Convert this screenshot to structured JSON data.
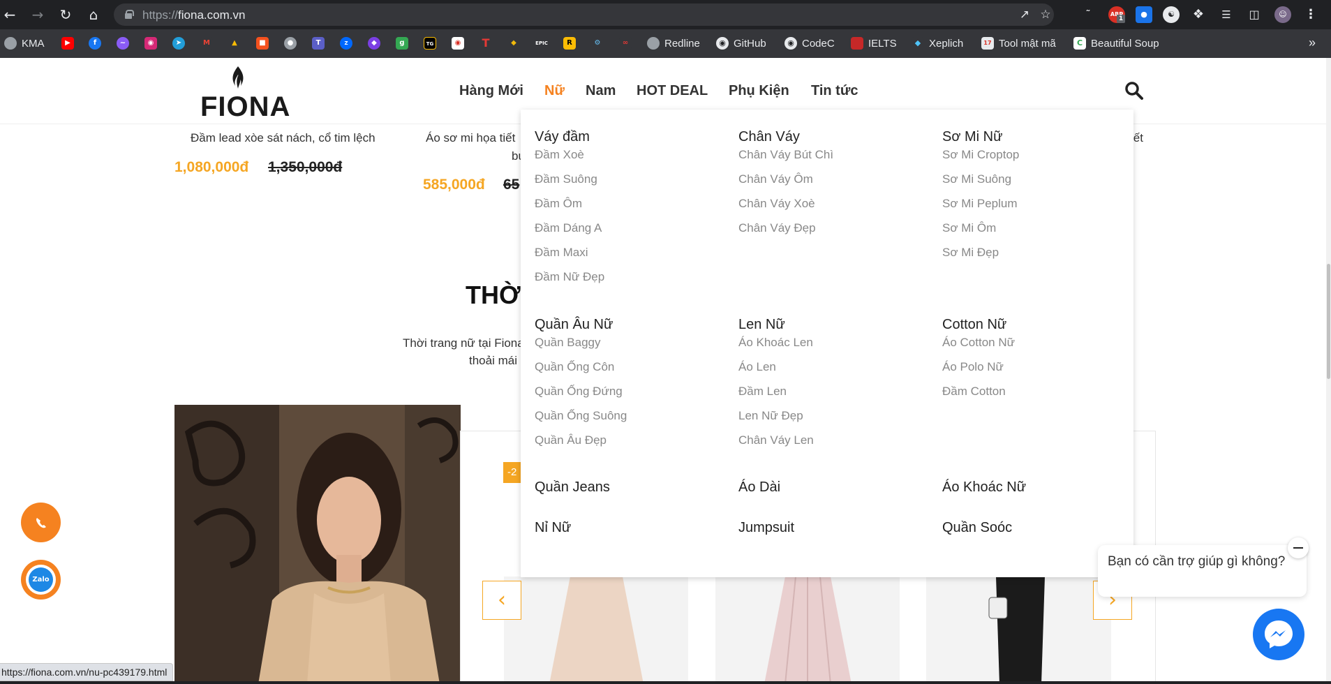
{
  "browser": {
    "url_scheme": "https://",
    "url_host": "fiona.com.vn",
    "status_url": "https://fiona.com.vn/nu-pc439179.html",
    "extension_badge": "1",
    "bookmarks": [
      {
        "label": "KMA",
        "icon": "globe-icon"
      },
      {
        "label": "Redline",
        "icon": "globe-icon"
      },
      {
        "label": "GitHub",
        "icon": "github-icon"
      },
      {
        "label": "CodeC",
        "icon": "github-icon"
      },
      {
        "label": "IELTS",
        "icon": "ielts-icon"
      },
      {
        "label": "Xeplich",
        "icon": "xeplich-icon"
      },
      {
        "label": "Tool mật mã",
        "icon": "calendar-icon"
      },
      {
        "label": "Beautiful Soup",
        "icon": "c-icon"
      }
    ]
  },
  "site": {
    "logo_text": "FIONA",
    "nav": [
      "Hàng Mới",
      "Nữ",
      "Nam",
      "HOT DEAL",
      "Phụ Kiện",
      "Tin tức"
    ],
    "active_nav": "Nữ",
    "accent_color": "#f58220",
    "price_color": "#f5a623"
  },
  "products": [
    {
      "name": "Đầm lead xòe sát nách, cổ tim lệch",
      "price": "1,080,000đ",
      "old_price": "1,350,000đ"
    },
    {
      "name_line1": "Áo sơ mi họa tiết",
      "name_line2": "bu",
      "price": "585,000đ",
      "old_price": "65"
    },
    {
      "name_tail": "iết"
    }
  ],
  "section": {
    "title": "THỜ",
    "desc_line1": "Thời trang nữ tại Fiona",
    "desc_line2": "thoải mái",
    "sale_tag": "-2"
  },
  "mega_menu": {
    "groups": [
      {
        "title": "Váy đầm",
        "items": [
          "Đầm Xoè",
          "Đầm Suông",
          "Đầm Ôm",
          "Đầm Dáng A",
          "Đầm Maxi",
          "Đầm Nữ Đẹp"
        ]
      },
      {
        "title": "Chân Váy",
        "items": [
          "Chân Váy Bút Chì",
          "Chân Váy Ôm",
          "Chân Váy Xoè",
          "Chân Váy Đẹp"
        ]
      },
      {
        "title": "Sơ Mi Nữ",
        "items": [
          "Sơ Mi Croptop",
          "Sơ Mi Suông",
          "Sơ Mi Peplum",
          "Sơ Mi Ôm",
          "Sơ Mi Đẹp"
        ]
      },
      {
        "title": "Quần Âu Nữ",
        "items": [
          "Quần Baggy",
          "Quần Ống Côn",
          "Quần Ống Đứng",
          "Quần Ống Suông",
          "Quần Âu Đẹp"
        ]
      },
      {
        "title": "Len Nữ",
        "items": [
          "Áo Khoác Len",
          "Áo Len",
          "Đầm Len",
          "Len Nữ Đẹp",
          "Chân Váy Len"
        ]
      },
      {
        "title": "Cotton Nữ",
        "items": [
          "Áo Cotton Nữ",
          "Áo Polo Nữ",
          "Đầm Cotton"
        ]
      }
    ],
    "singles": [
      "Quần Jeans",
      "Áo Dài",
      "Áo Khoác Nữ",
      "Nỉ Nữ",
      "Jumpsuit",
      "Quần Soóc"
    ]
  },
  "chat": {
    "prompt": "Bạn có cần trợ giúp gì không?"
  }
}
